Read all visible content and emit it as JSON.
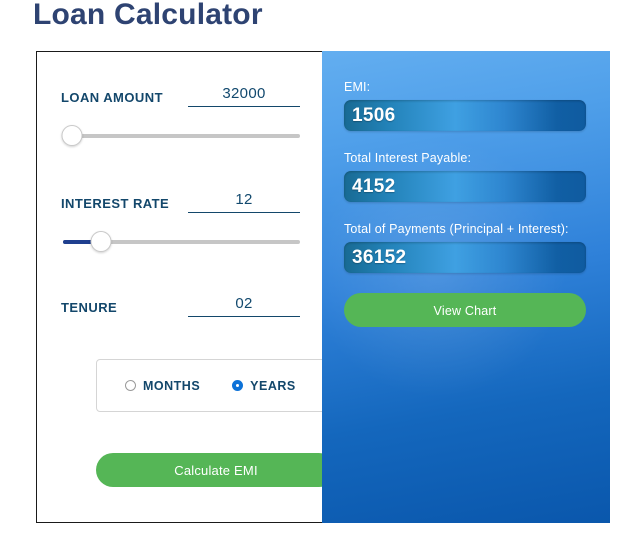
{
  "page": {
    "title": "Loan Calculator",
    "title_color": "#2e4372",
    "background": "#ffffff"
  },
  "form": {
    "fields": [
      {
        "id": "loan-amount",
        "label": "LOAN AMOUNT",
        "value": "32000",
        "placeholder": "Loan amount",
        "slider": {
          "percent": 4,
          "fill_percent": 0
        }
      },
      {
        "id": "interest-rate",
        "label": "INTEREST RATE",
        "value": "12",
        "placeholder": "Interest rate",
        "slider": {
          "percent": 16,
          "fill_percent": 16
        }
      },
      {
        "id": "tenure",
        "label": "TENURE",
        "value": "02",
        "placeholder": "Tenure"
      }
    ],
    "unit_selector": {
      "options": [
        {
          "id": "months",
          "label": "MONTHS",
          "selected": false
        },
        {
          "id": "years",
          "label": "YEARS",
          "selected": true
        }
      ]
    },
    "calculate_button": "Calculate EMI"
  },
  "results": {
    "items": [
      {
        "id": "emi",
        "label": "EMI:",
        "value": "1506"
      },
      {
        "id": "total-interest",
        "label": "Total Interest Payable:",
        "value": "4152"
      },
      {
        "id": "total-payments",
        "label": "Total of Payments (Principal + Interest):",
        "value": "36152"
      }
    ],
    "view_chart_button": "View Chart"
  },
  "colors": {
    "accent_green": "#55b656",
    "accent_blue": "#0d72d8",
    "label_blue": "#13476b",
    "slider_fill": "#1f3f8f",
    "panel_blue_light": "#63aef0",
    "panel_blue_dark": "#0a57ac"
  }
}
